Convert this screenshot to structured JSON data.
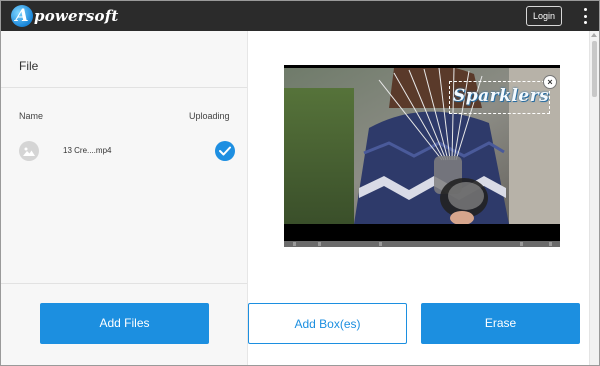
{
  "header": {
    "brand_initial": "A",
    "brand_rest": "powersoft",
    "login_label": "Login",
    "menu_icon": "vertical-dots-icon"
  },
  "file_panel": {
    "title": "File",
    "col_name": "Name",
    "col_uploading": "Uploading",
    "files": [
      {
        "name": "13 Cre....mp4",
        "thumb_icon": "image-icon",
        "status_icon": "checkmark-icon"
      }
    ]
  },
  "preview": {
    "watermark_text": "Sparklers",
    "close_label": "×"
  },
  "actions": {
    "add_files": "Add Files",
    "add_boxes": "Add Box(es)",
    "erase": "Erase"
  },
  "colors": {
    "accent": "#1c8fe0",
    "topbar": "#2b2b2b",
    "panel_bg": "#f7f7f7"
  }
}
